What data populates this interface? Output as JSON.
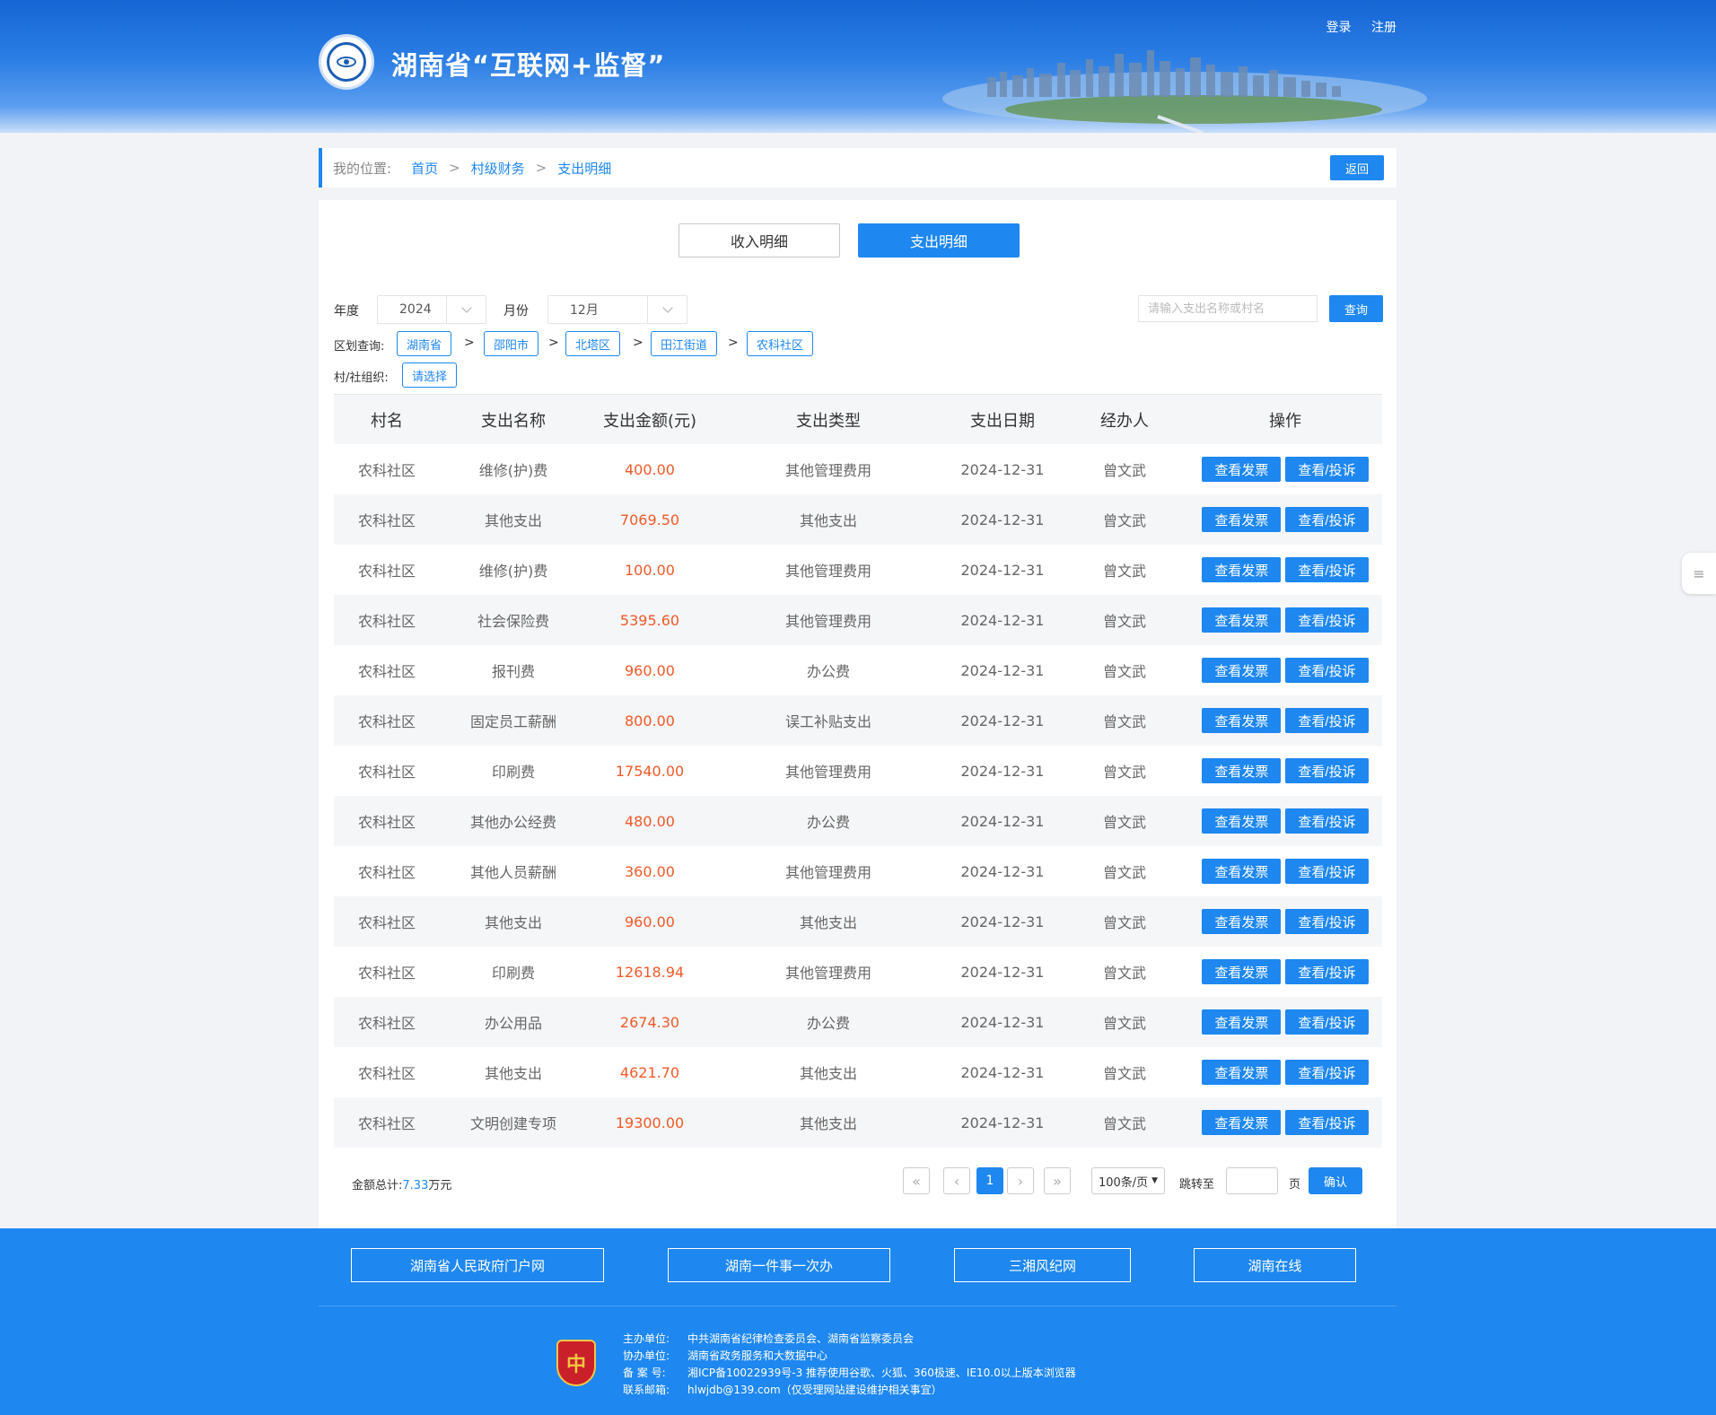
{
  "header": {
    "title": "湖南省“互联网+监督”",
    "login": "登录",
    "register": "注册"
  },
  "breadcrumb": {
    "label": "我的位置:",
    "items": [
      "首页",
      "村级财务",
      "支出明细"
    ],
    "separator": ">",
    "back": "返回"
  },
  "tabs": {
    "income": "收入明细",
    "expense": "支出明细",
    "active": "expense"
  },
  "filters": {
    "year_label": "年度",
    "year_value": "2024",
    "month_label": "月份",
    "month_value": "12月",
    "search_placeholder": "请输入支出名称或村名",
    "query_button": "查询",
    "region_label": "区划查询:",
    "regions": [
      "湖南省",
      "邵阳市",
      "北塔区",
      "田江街道",
      "农科社区"
    ],
    "org_label": "村/社组织:",
    "org_value": "请选择"
  },
  "table": {
    "headers": [
      "村名",
      "支出名称",
      "支出金额(元)",
      "支出类型",
      "支出日期",
      "经办人",
      "操作"
    ],
    "action_invoice": "查看发票",
    "action_complain": "查看/投诉",
    "rows": [
      {
        "village": "农科社区",
        "name": "维修(护)费",
        "amount": "400.00",
        "type": "其他管理费用",
        "date": "2024-12-31",
        "handler": "曾文武"
      },
      {
        "village": "农科社区",
        "name": "其他支出",
        "amount": "7069.50",
        "type": "其他支出",
        "date": "2024-12-31",
        "handler": "曾文武"
      },
      {
        "village": "农科社区",
        "name": "维修(护)费",
        "amount": "100.00",
        "type": "其他管理费用",
        "date": "2024-12-31",
        "handler": "曾文武"
      },
      {
        "village": "农科社区",
        "name": "社会保险费",
        "amount": "5395.60",
        "type": "其他管理费用",
        "date": "2024-12-31",
        "handler": "曾文武"
      },
      {
        "village": "农科社区",
        "name": "报刊费",
        "amount": "960.00",
        "type": "办公费",
        "date": "2024-12-31",
        "handler": "曾文武"
      },
      {
        "village": "农科社区",
        "name": "固定员工薪酬",
        "amount": "800.00",
        "type": "误工补贴支出",
        "date": "2024-12-31",
        "handler": "曾文武"
      },
      {
        "village": "农科社区",
        "name": "印刷费",
        "amount": "17540.00",
        "type": "其他管理费用",
        "date": "2024-12-31",
        "handler": "曾文武"
      },
      {
        "village": "农科社区",
        "name": "其他办公经费",
        "amount": "480.00",
        "type": "办公费",
        "date": "2024-12-31",
        "handler": "曾文武"
      },
      {
        "village": "农科社区",
        "name": "其他人员薪酬",
        "amount": "360.00",
        "type": "其他管理费用",
        "date": "2024-12-31",
        "handler": "曾文武"
      },
      {
        "village": "农科社区",
        "name": "其他支出",
        "amount": "960.00",
        "type": "其他支出",
        "date": "2024-12-31",
        "handler": "曾文武"
      },
      {
        "village": "农科社区",
        "name": "印刷费",
        "amount": "12618.94",
        "type": "其他管理费用",
        "date": "2024-12-31",
        "handler": "曾文武"
      },
      {
        "village": "农科社区",
        "name": "办公用品",
        "amount": "2674.30",
        "type": "办公费",
        "date": "2024-12-31",
        "handler": "曾文武"
      },
      {
        "village": "农科社区",
        "name": "其他支出",
        "amount": "4621.70",
        "type": "其他支出",
        "date": "2024-12-31",
        "handler": "曾文武"
      },
      {
        "village": "农科社区",
        "name": "文明创建专项",
        "amount": "19300.00",
        "type": "其他支出",
        "date": "2024-12-31",
        "handler": "曾文武"
      }
    ]
  },
  "summary": {
    "label": "金额总计:",
    "value": "7.33",
    "unit": "万元"
  },
  "pager": {
    "first": "«",
    "prev": "‹",
    "current": "1",
    "next": "›",
    "last": "»",
    "page_size": "100条/页",
    "jump_label": "跳转至",
    "page_unit": "页",
    "confirm": "确认"
  },
  "footer": {
    "links": [
      "湖南省人民政府门户网",
      "湖南一件事一次办",
      "三湘风纪网",
      "湖南在线"
    ],
    "badge_char": "中",
    "info": [
      {
        "key": "主办单位:",
        "value": "中共湖南省纪律检查委员会、湖南省监察委员会"
      },
      {
        "key": "协办单位:",
        "value": "湖南省政务服务和大数据中心"
      },
      {
        "key": "备 案 号:",
        "value": "湘ICP备10022939号-3  推荐使用谷歌、火狐、360极速、IE10.0以上版本浏览器"
      },
      {
        "key": "联系邮箱:",
        "value": "hlwjdb@139.com（仅受理网站建设维护相关事宜）"
      }
    ]
  },
  "colors": {
    "accent": "#1e87f0",
    "amount": "#f05a28",
    "footer_bg": "#1e87f0"
  }
}
